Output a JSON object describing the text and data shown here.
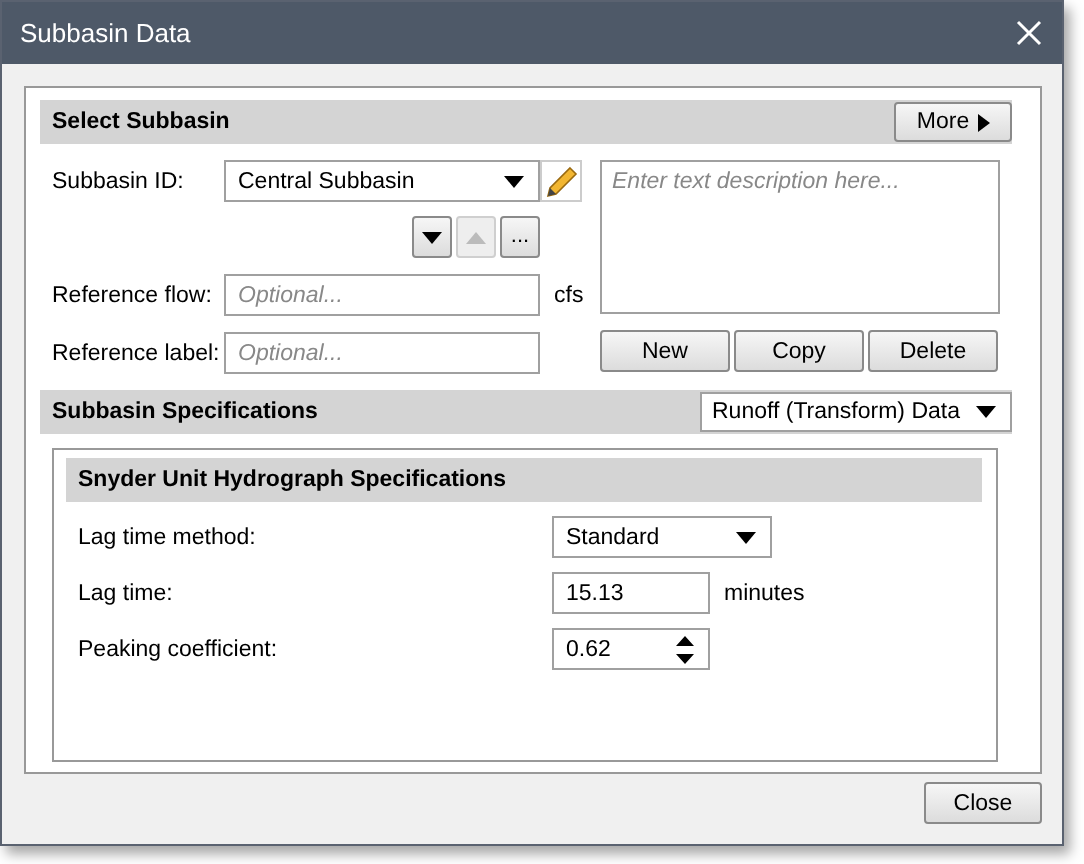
{
  "window": {
    "title": "Subbasin Data"
  },
  "select_section": {
    "title": "Select Subbasin",
    "more_button": "More",
    "subbasin_id": {
      "label": "Subbasin ID:",
      "value": "Central Subbasin"
    },
    "nav_buttons": [
      {
        "kind": "down",
        "disabled": false
      },
      {
        "kind": "up",
        "disabled": true
      },
      {
        "kind": "more",
        "label": "...",
        "disabled": false
      }
    ],
    "description": {
      "placeholder": "Enter text description here..."
    },
    "reference_flow": {
      "label": "Reference flow:",
      "placeholder": "Optional...",
      "unit": "cfs"
    },
    "reference_label": {
      "label": "Reference label:",
      "placeholder": "Optional..."
    },
    "actions": [
      "New",
      "Copy",
      "Delete"
    ]
  },
  "specs_section": {
    "title": "Subbasin Specifications",
    "dropdown": "Runoff (Transform) Data",
    "panel": {
      "title": "Snyder Unit Hydrograph Specifications",
      "fields": [
        {
          "kind": "dropdown",
          "label": "Lag time method:",
          "value": "Standard"
        },
        {
          "kind": "text",
          "label": "Lag time:",
          "value": "15.13",
          "unit": "minutes"
        },
        {
          "kind": "spinner",
          "label": "Peaking coefficient:",
          "value": "0.62"
        }
      ]
    }
  },
  "footer": {
    "close_button": "Close"
  }
}
